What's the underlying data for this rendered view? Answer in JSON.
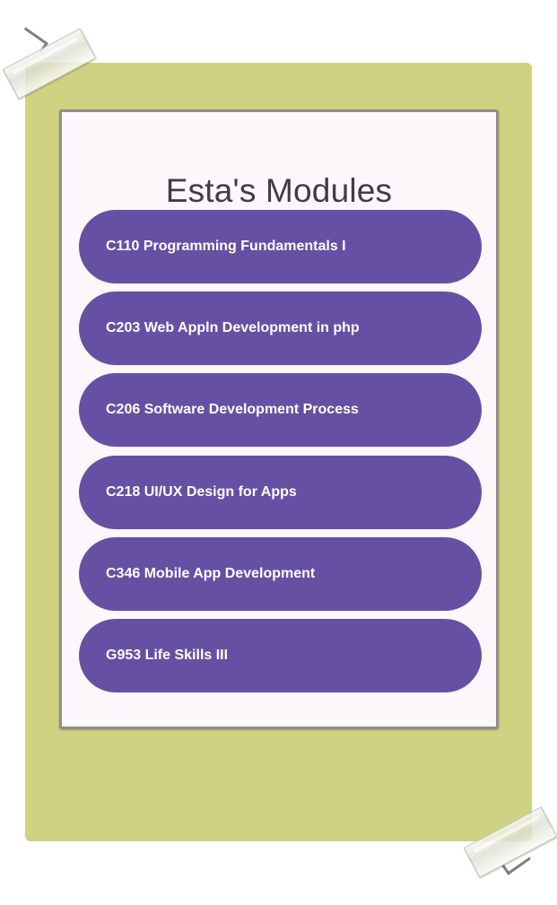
{
  "screen": {
    "title": "Esta's Modules"
  },
  "modules": [
    {
      "label": "C110 Programming Fundamentals I"
    },
    {
      "label": "C203 Web Appln Development in php"
    },
    {
      "label": "C206 Software Development Process"
    },
    {
      "label": "C218 UI/UX Design for Apps"
    },
    {
      "label": "C346 Mobile App Development"
    },
    {
      "label": "G953 Life Skills III"
    }
  ],
  "colors": {
    "background_board": "#cfd281",
    "screen_background": "#fcf7fb",
    "button_primary": "#6650a4",
    "button_text": "#ffffff",
    "title_text": "#3f3c45"
  }
}
